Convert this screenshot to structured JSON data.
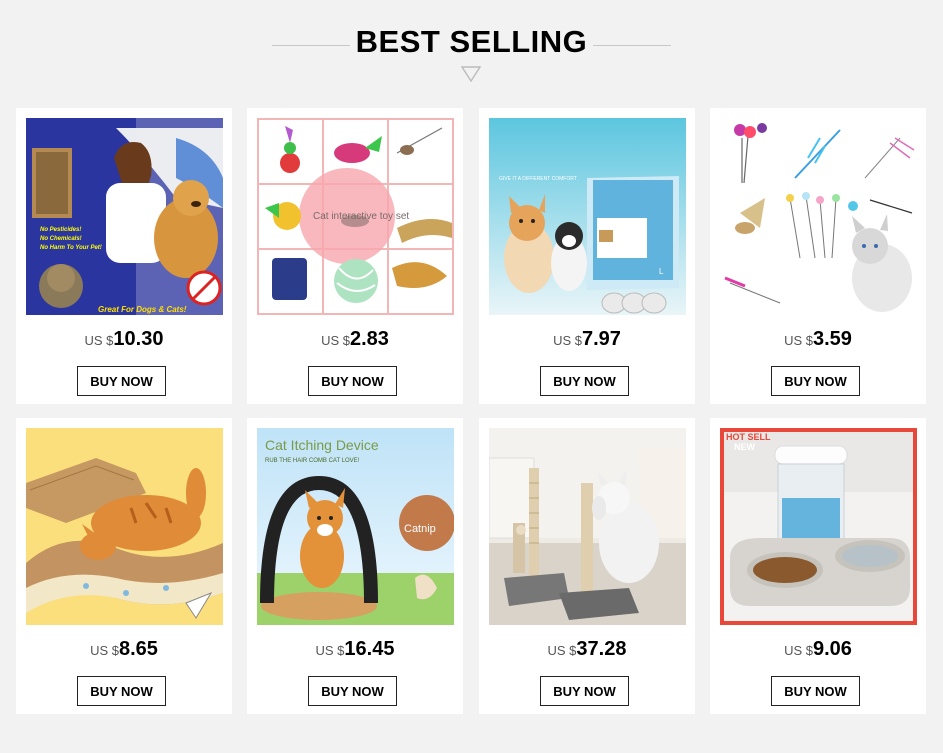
{
  "header": {
    "title": "BEST SELLING"
  },
  "products": [
    {
      "currency": "US $",
      "price": "10.30",
      "button": "BUY NOW",
      "image_icon": "dog-grooming-brush",
      "image_text": {
        "checks": [
          "No Pesticides!",
          "No Chemicals!",
          "No Harm To Your Pet!"
        ],
        "banner": "Great For Dogs & Cats!"
      }
    },
    {
      "currency": "US $",
      "price": "2.83",
      "button": "BUY NOW",
      "image_icon": "cat-toy-set",
      "image_text": {
        "overlay": "Cat interactive toy set"
      }
    },
    {
      "currency": "US $",
      "price": "7.97",
      "button": "BUY NOW",
      "image_icon": "pet-pee-pads",
      "image_text": {
        "tagline": "GIVE IT A DIFFERENT COMFORT",
        "pack_size": "L"
      }
    },
    {
      "currency": "US $",
      "price": "3.59",
      "button": "BUY NOW",
      "image_icon": "feather-wand-toys"
    },
    {
      "currency": "US $",
      "price": "8.65",
      "button": "BUY NOW",
      "image_icon": "cardboard-scratcher"
    },
    {
      "currency": "US $",
      "price": "16.45",
      "button": "BUY NOW",
      "image_icon": "cat-itching-arch",
      "image_text": {
        "title": "Cat Itching Device",
        "subtitle": "RUB THE HAIR COMB CAT LOVE!",
        "badge": "Catnip"
      }
    },
    {
      "currency": "US $",
      "price": "37.28",
      "button": "BUY NOW",
      "image_icon": "cat-scratching-post"
    },
    {
      "currency": "US $",
      "price": "9.06",
      "button": "BUY NOW",
      "image_icon": "pet-water-feeder",
      "image_text": {
        "badge_top": "HOT SELL",
        "badge_bottom": "NEW"
      }
    }
  ],
  "colors": {
    "background": "#f2f2f2",
    "card": "#ffffff",
    "text": "#000000",
    "divider": "#c8c8c8"
  }
}
